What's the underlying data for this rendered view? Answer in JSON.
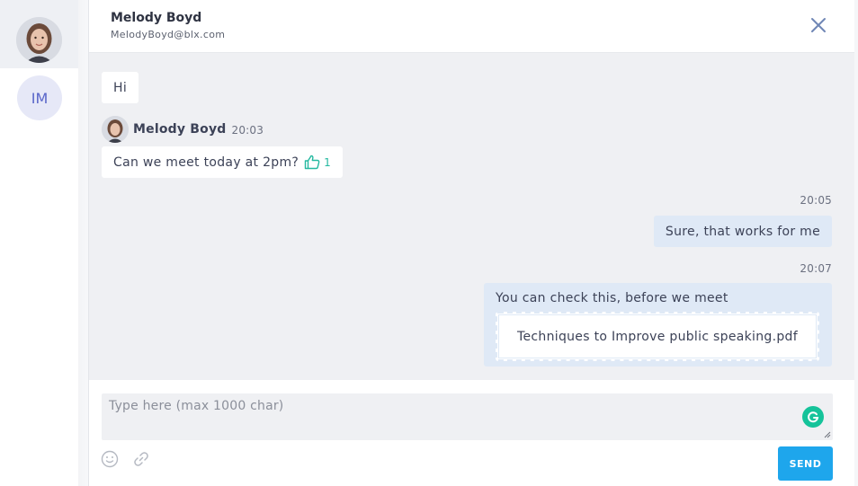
{
  "sidebar": {
    "contacts": [
      {
        "type": "photo",
        "active": true
      },
      {
        "type": "initials",
        "initials": "IM"
      }
    ]
  },
  "header": {
    "name": "Melody Boyd",
    "email": "MelodyBoyd@blx.com"
  },
  "messages": {
    "items": [
      {
        "direction": "in",
        "text": "Hi"
      },
      {
        "direction": "in",
        "sender": "Melody Boyd",
        "time": "20:03",
        "text": "Can we meet today at 2pm?",
        "likes": "1"
      },
      {
        "direction": "out",
        "time": "20:05",
        "text": "Sure, that works for me"
      },
      {
        "direction": "out",
        "time": "20:07",
        "text": "You can check this, before we meet",
        "attachment": "Techniques to Improve public speaking.pdf"
      }
    ]
  },
  "composer": {
    "placeholder": "Type here (max 1000 char)",
    "send_label": "SEND"
  },
  "colors": {
    "accent": "#1ea6ec",
    "outgoing_bubble": "#dfe9f6",
    "like": "#25b9a0",
    "grammarly": "#15c39a"
  },
  "icons": [
    "close-icon",
    "thumbs-up-icon",
    "grammarly-icon",
    "emoji-icon",
    "link-icon"
  ]
}
